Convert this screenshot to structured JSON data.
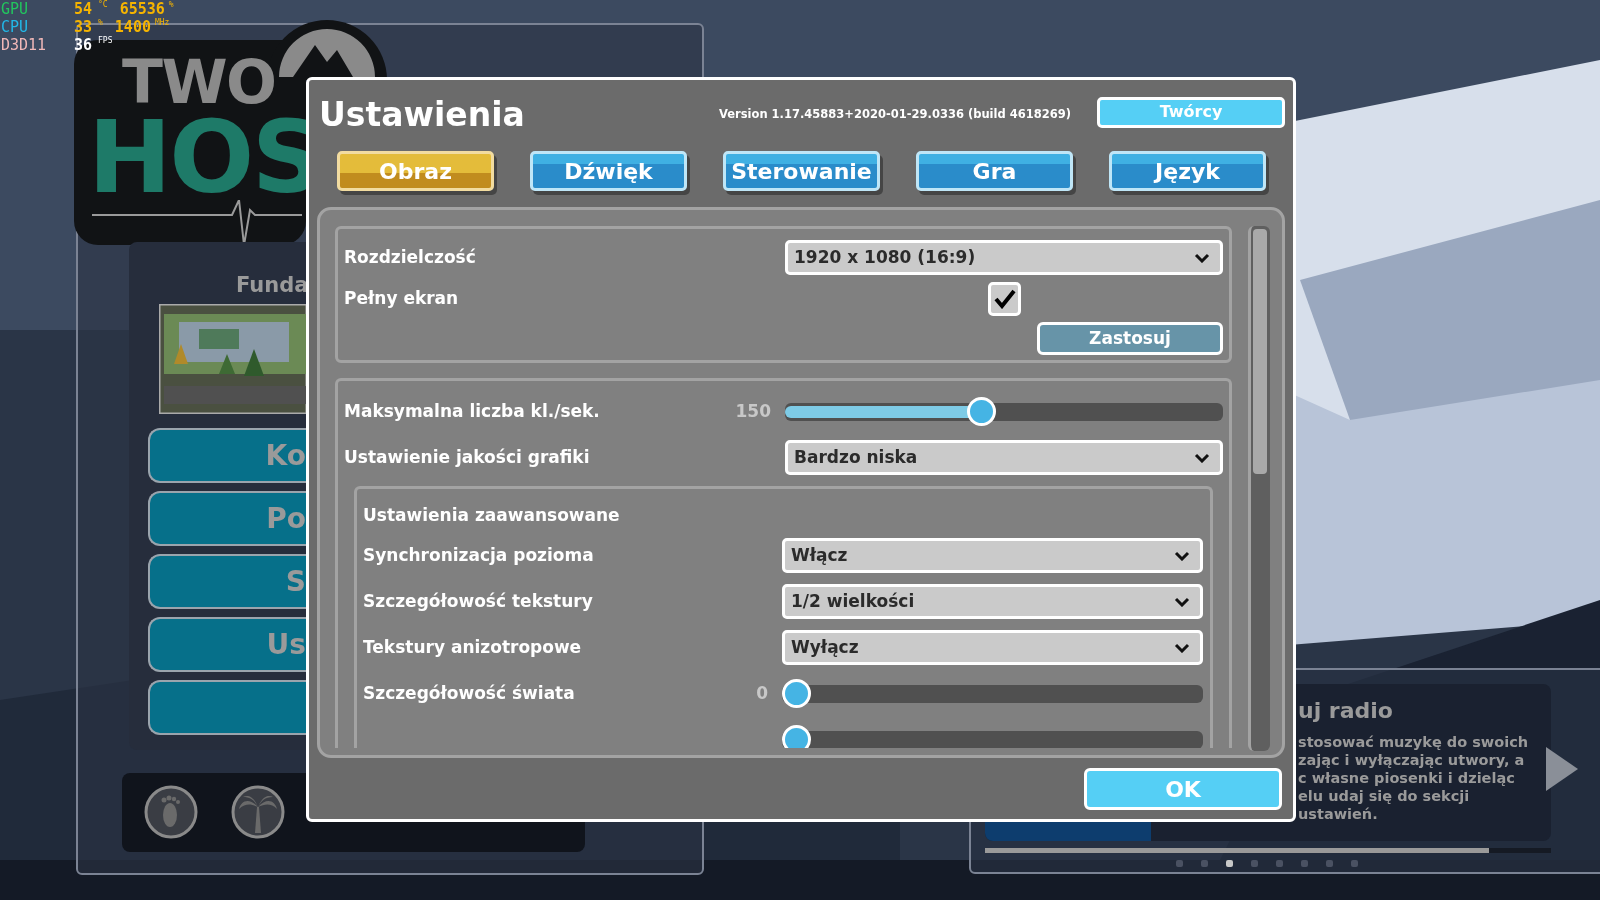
{
  "hud": [
    {
      "label": "GPU",
      "color": "#22c55e",
      "values": [
        {
          "text": "54",
          "unit": "°C",
          "color": "#f5b400"
        },
        {
          "text": "65536",
          "unit": "%",
          "color": "#f5b400"
        }
      ]
    },
    {
      "label": "CPU",
      "color": "#22b8e8",
      "values": [
        {
          "text": "33",
          "unit": "%",
          "color": "#f5b400"
        },
        {
          "text": "1400",
          "unit": "MHz",
          "color": "#f5b400"
        }
      ]
    },
    {
      "label": "D3D11",
      "color": "#f0b8b8",
      "values": [
        {
          "text": "36",
          "unit": "FPS",
          "color": "#ffffff"
        }
      ]
    }
  ],
  "logo": {
    "line1": "TWO",
    "line2": "HOS"
  },
  "menu_panel": {
    "title": "Funda",
    "buttons": [
      {
        "kind": "text",
        "label": "Ko"
      },
      {
        "kind": "text",
        "label": "Po"
      },
      {
        "kind": "text",
        "label": "S"
      },
      {
        "kind": "text",
        "label": "Us"
      },
      {
        "kind": "blank"
      }
    ],
    "footer_icons": [
      {
        "kind": "foot"
      },
      {
        "kind": "palm"
      }
    ]
  },
  "news_panel": {
    "title": "uj radio",
    "lines": [
      "stosować muzykę do swoich",
      "zając i wyłączając utwory, a",
      "c własne piosenki i dzieląc",
      "elu udaj się do sekcji",
      "ustawień."
    ],
    "progress": {
      "level": 0.89
    },
    "pages": [
      {
        "selected": false
      },
      {
        "selected": false
      },
      {
        "selected": true
      },
      {
        "selected": false
      },
      {
        "selected": false
      },
      {
        "selected": false
      },
      {
        "selected": false
      },
      {
        "selected": false
      }
    ]
  },
  "dialog": {
    "title": "Ustawienia",
    "version": "Version 1.17.45883+2020-01-29.0336 (build 4618269)",
    "credits_button": "Twórcy",
    "tabs": [
      {
        "label": "Obraz",
        "selected": true
      },
      {
        "label": "Dźwięk",
        "selected": false
      },
      {
        "label": "Sterowanie",
        "selected": false
      },
      {
        "label": "Gra",
        "selected": false
      },
      {
        "label": "Język",
        "selected": false
      }
    ],
    "display": {
      "resolution": {
        "label": "Rozdzielczość",
        "value": "1920 x 1080 (16:9)"
      },
      "fullscreen": {
        "label": "Pełny ekran",
        "checked": true
      },
      "apply_button": "Zastosuj"
    },
    "quality": {
      "rows": [
        {
          "kind": "slider",
          "label": "Maksymalna liczba kl./sek.",
          "reading": "150",
          "level": 0.445
        },
        {
          "kind": "dropdown",
          "label": "Ustawienie jakości grafiki",
          "value": "Bardzo niska"
        }
      ],
      "advanced": {
        "title": "Ustawienia zaawansowane",
        "rows": [
          {
            "kind": "dropdown",
            "label": "Synchronizacja pozioma",
            "value": "Włącz"
          },
          {
            "kind": "dropdown",
            "label": "Szczegółowość tekstury",
            "value": "1/2 wielkości"
          },
          {
            "kind": "dropdown",
            "label": "Tekstury anizotropowe",
            "value": "Wyłącz"
          },
          {
            "kind": "slider",
            "label": "Szczegółowość świata",
            "reading": "0",
            "level": 0
          },
          {
            "kind": "slider",
            "level": 0
          }
        ]
      }
    },
    "ok_button": "OK"
  }
}
